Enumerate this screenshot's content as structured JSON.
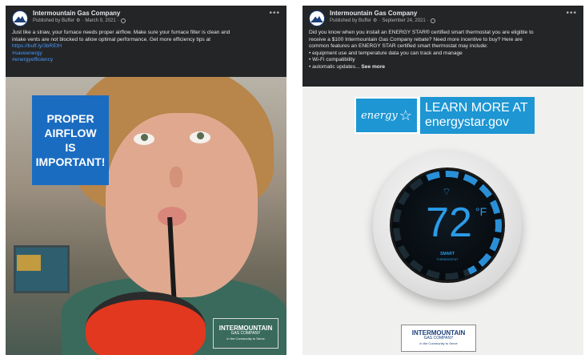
{
  "posts": [
    {
      "page_name": "Intermountain Gas Company",
      "published_by": "Published by Buffer",
      "date": "March 9, 2021",
      "text_lines": [
        "Just like a straw, your furnace needs proper airflow. Make sure your furnace filter is clean and",
        "intake vents are not blocked to allow optimal performance. Get more efficiency tips at"
      ],
      "link": "https://buff.ly/3bREtH",
      "hashtags": [
        "#saveenergy",
        "#energyefficiency"
      ],
      "image": {
        "headline": [
          "PROPER",
          "AIRFLOW",
          "IS",
          "IMPORTANT!"
        ],
        "logo_name": "INTERMOUNTAIN",
        "logo_sub": "GAS COMPANY",
        "logo_tag": "In the Community to Serve"
      }
    },
    {
      "page_name": "Intermountain Gas Company",
      "published_by": "Published by Buffer",
      "date": "September 24, 2021",
      "text_lines": [
        "Did you know when you install an ENERGY STAR® certified smart thermostat you are eligible to",
        "receive a $100 Intermountain Gas Company rebate? Need more incentive to buy? Here are",
        "common features an ENERGY STAR certified smart thermostat may include:",
        "• equipment use and temperature data you can track and manage",
        "• Wi-Fi compatibility"
      ],
      "last_line": "• automatic updates...",
      "see_more": "See more",
      "image": {
        "energy_star_logo": "energy",
        "cta_line1": "LEARN MORE AT",
        "cta_line2": "energystar.gov",
        "temperature": "72",
        "unit": "°F",
        "smart_label": "SMART",
        "thermostat_label": "THERMOSTAT",
        "logo_name": "INTERMOUNTAIN",
        "logo_sub": "GAS COMPANY",
        "logo_tag": "In the Community to Serve"
      }
    }
  ],
  "icons": {
    "more": "more-options-icon",
    "globe": "globe-icon",
    "gear": "gear-icon",
    "wifi": "wifi-icon",
    "star": "energy-star-icon"
  },
  "colors": {
    "post_bg": "#242526",
    "link": "#4599ff",
    "headline_bg": "#1a6cc1",
    "energy_star_blue": "#1d96d3",
    "thermostat_blue": "#2a9be8"
  }
}
